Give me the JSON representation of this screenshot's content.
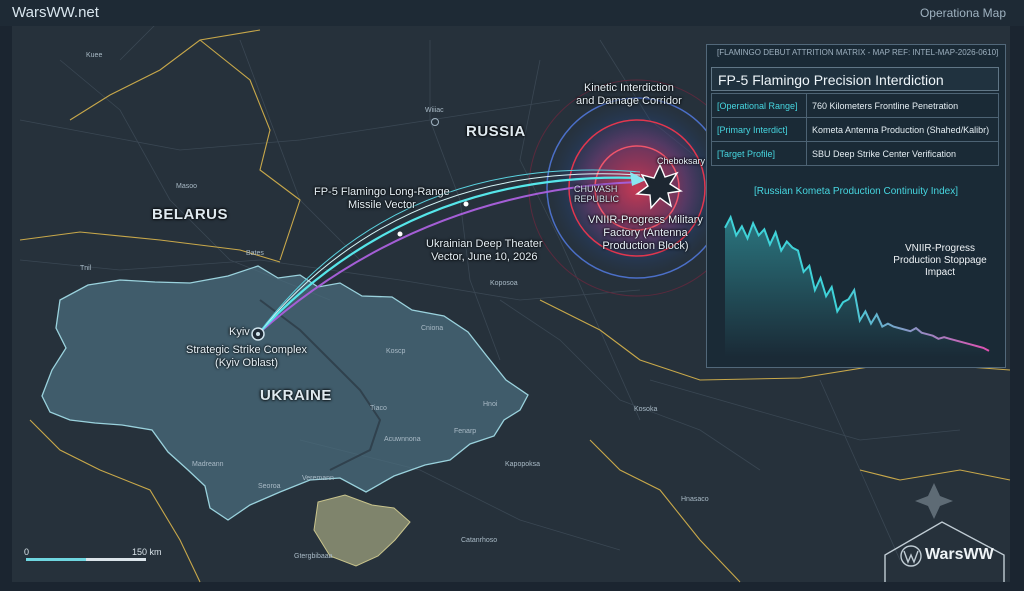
{
  "header": {
    "brand": "WarsWW.net",
    "map_title": "Operationa Map"
  },
  "countries": {
    "belarus": "BELARUS",
    "russia": "RUSSIA",
    "ukraine": "UKRAINE"
  },
  "places": {
    "kyiv": "Kyiv",
    "cheboksary": "Cheboksary",
    "chuvash": "CHUVASH\nREPUBLIC",
    "cities": [
      "Kuee",
      "Wiiiac",
      "Masoo",
      "Bates",
      "Tnil",
      "Koposoa",
      "Cniona",
      "Koscp",
      "Tiaco",
      "Acuwnnona",
      "Fenarp",
      "Hnoi",
      "Kapopoksa",
      "Madreann",
      "Seoroa",
      "Veremann",
      "Kosoka",
      "Hnasaco",
      "Catanrhoso",
      "Gtergbibaaa"
    ]
  },
  "callouts": {
    "strike_complex": "Strategic Strike Complex\n(Kyiv Oblast)",
    "missile_vector": "FP-5 Flamingo Long-Range\nMissile Vector",
    "deep_theater": "Ukrainian Deep Theater\nVector, June 10, 2026",
    "corridor": "Kinetic Interdiction\nand Damage Corridor",
    "factory": "VNIIR-Progress Military\nFactory (Antenna\nProduction Block)"
  },
  "panel": {
    "ref": "[FLAMINGO DEBUT ATTRITION MATRIX - MAP REF: INTEL-MAP-2026-0610]",
    "title": "FP-5 Flamingo Precision Interdiction",
    "rows": [
      {
        "key": "[Operational Range]",
        "value": "760 Kilometers Frontline Penetration"
      },
      {
        "key": "[Primary Interdict]",
        "value": "Kometa Antenna Production (Shahed/Kalibr)"
      },
      {
        "key": "[Target Profile]",
        "value": "SBU Deep Strike Center Verification"
      }
    ]
  },
  "chart_data": {
    "type": "area",
    "title": "[Russian Kometa Production Continuity Index]",
    "annotations": [
      "VNIIR-Progress\nProduction Stoppage\nImpact"
    ],
    "values": [
      85,
      92,
      80,
      86,
      78,
      88,
      80,
      84,
      74,
      82,
      70,
      76,
      72,
      70,
      56,
      60,
      44,
      52,
      40,
      46,
      30,
      36,
      38,
      44,
      24,
      30,
      22,
      28,
      20,
      22,
      20,
      19,
      18,
      17,
      19,
      16,
      15,
      14,
      12,
      13,
      12,
      11,
      10,
      9,
      8,
      7,
      6,
      4
    ],
    "color_start": "#3fd3d9",
    "color_end": "#e04fb0"
  },
  "scale": {
    "zero": "0",
    "distance": "150 km"
  },
  "watermark": "WarsWW",
  "colors": {
    "ukraine_fill": "#4b6e7e",
    "crimea_fill": "#8a8e72",
    "target_red": "#d63a4e",
    "target_blue": "#3a5fb0",
    "missile": "#56e6ea",
    "vector_purple": "#a45ed6"
  }
}
